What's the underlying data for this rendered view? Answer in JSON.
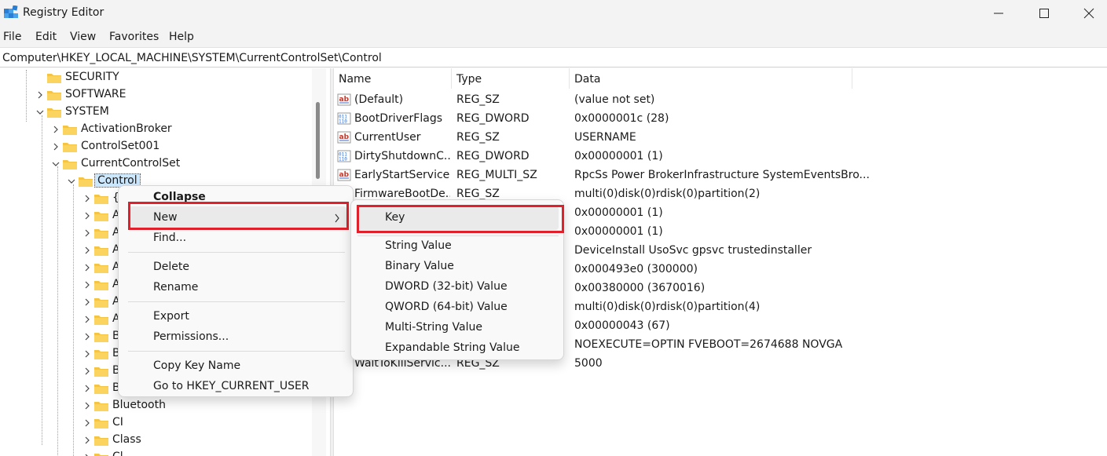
{
  "window": {
    "title": "Registry Editor"
  },
  "menubar": [
    "File",
    "Edit",
    "View",
    "Favorites",
    "Help"
  ],
  "address": "Computer\\HKEY_LOCAL_MACHINE\\SYSTEM\\CurrentControlSet\\Control",
  "tree": [
    {
      "label": "SECURITY",
      "expanded": false
    },
    {
      "label": "SOFTWARE",
      "expanded": false
    },
    {
      "label": "SYSTEM",
      "expanded": true
    },
    {
      "label": "ActivationBroker",
      "expanded": false
    },
    {
      "label": "ControlSet001",
      "expanded": false
    },
    {
      "label": "CurrentControlSet",
      "expanded": true
    },
    {
      "label": "Control",
      "expanded": true,
      "selected": true
    },
    {
      "label": "{",
      "expanded": false
    },
    {
      "label": "A",
      "expanded": false
    },
    {
      "label": "A",
      "expanded": false
    },
    {
      "label": "A",
      "expanded": false
    },
    {
      "label": "A",
      "expanded": false
    },
    {
      "label": "A",
      "expanded": false
    },
    {
      "label": "A",
      "expanded": false
    },
    {
      "label": "A",
      "expanded": false
    },
    {
      "label": "B",
      "expanded": false
    },
    {
      "label": "B",
      "expanded": false
    },
    {
      "label": "B",
      "expanded": false
    },
    {
      "label": "B",
      "expanded": false
    },
    {
      "label": "Bluetooth",
      "expanded": false
    },
    {
      "label": "CI",
      "expanded": false
    },
    {
      "label": "Class",
      "expanded": false
    },
    {
      "label": "Cl",
      "expanded": false
    }
  ],
  "columns": {
    "name": "Name",
    "type": "Type",
    "data": "Data"
  },
  "values": [
    {
      "icon": "string-value-icon",
      "name": "(Default)",
      "type": "REG_SZ",
      "data": "(value not set)"
    },
    {
      "icon": "binary-value-icon",
      "name": "BootDriverFlags",
      "type": "REG_DWORD",
      "data": "0x0000001c (28)"
    },
    {
      "icon": "string-value-icon",
      "name": "CurrentUser",
      "type": "REG_SZ",
      "data": "USERNAME"
    },
    {
      "icon": "binary-value-icon",
      "name": "DirtyShutdownC...",
      "type": "REG_DWORD",
      "data": "0x00000001 (1)"
    },
    {
      "icon": "string-value-icon",
      "name": "EarlyStartServices",
      "type": "REG_MULTI_SZ",
      "data": "RpcSs Power BrokerInfrastructure SystemEventsBro..."
    },
    {
      "icon": "",
      "name": "FirmwareBootDe...",
      "type": "REG_SZ",
      "data": "multi(0)disk(0)rdisk(0)partition(2)"
    },
    {
      "icon": "",
      "name": "",
      "type": "",
      "data": "0x00000001 (1)"
    },
    {
      "icon": "",
      "name": "",
      "type": "",
      "data": "0x00000001 (1)"
    },
    {
      "icon": "",
      "name": "",
      "type": "",
      "data": "DeviceInstall UsoSvc gpsvc trustedinstaller"
    },
    {
      "icon": "",
      "name": "",
      "type": "",
      "data": "0x000493e0 (300000)"
    },
    {
      "icon": "",
      "name": "",
      "type": "",
      "data": "0x00380000 (3670016)"
    },
    {
      "icon": "",
      "name": "",
      "type": "",
      "data": "multi(0)disk(0)rdisk(0)partition(4)"
    },
    {
      "icon": "",
      "name": "",
      "type": "",
      "data": "0x00000043 (67)"
    },
    {
      "icon": "",
      "name": "",
      "type": "",
      "data": " NOEXECUTE=OPTIN  FVEBOOT=2674688  NOVGA"
    },
    {
      "icon": "",
      "name": "WaitToKillServic...",
      "type": "REG_SZ",
      "data": "5000"
    }
  ],
  "context_menu": {
    "collapse": "Collapse",
    "new": "New",
    "find": "Find...",
    "delete": "Delete",
    "rename": "Rename",
    "export": "Export",
    "permissions": "Permissions...",
    "copy_key_name": "Copy Key Name",
    "goto_hkcu": "Go to HKEY_CURRENT_USER"
  },
  "new_submenu": {
    "key": "Key",
    "string_value": "String Value",
    "binary_value": "Binary Value",
    "dword_value": "DWORD (32-bit) Value",
    "qword_value": "QWORD (64-bit) Value",
    "multi_string_value": "Multi-String Value",
    "expandable_string_value": "Expandable String Value"
  },
  "colors": {
    "highlight_border": "#e0202a",
    "folder": "#f6c443",
    "selection": "#cce8ff"
  }
}
